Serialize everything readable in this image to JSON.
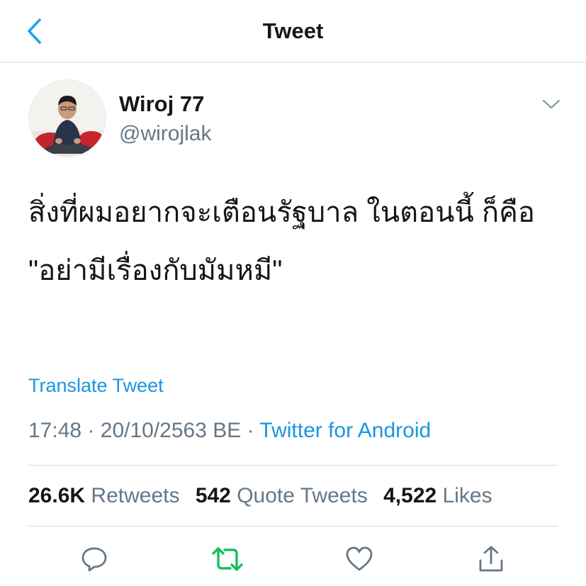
{
  "header": {
    "title": "Tweet",
    "back_icon": "chevron-left-icon"
  },
  "author": {
    "display_name": "Wiroj 77",
    "handle": "@wirojlak",
    "avatar": "avatar-photo"
  },
  "tweet": {
    "paragraphs": [
      "สิ่งที่ผมอยากจะเตือนรัฐบาล ในตอนนี้ ก็คือ",
      "\"อย่ามีเรื่องกับมัมหมี\""
    ],
    "translate_label": "Translate Tweet",
    "time": "17:48",
    "date": "20/10/2563 BE",
    "separator": "·",
    "source": "Twitter for Android"
  },
  "stats": {
    "retweets_count": "26.6K",
    "retweets_label": "Retweets",
    "quote_count": "542",
    "quote_label": "Quote Tweets",
    "likes_count": "4,522",
    "likes_label": "Likes"
  },
  "actions": [
    "reply-icon",
    "retweet-icon",
    "like-icon",
    "share-icon"
  ],
  "colors": {
    "link_blue": "#1b95e0",
    "back_blue": "#1da1f2",
    "retweet_green": "#17bf63",
    "secondary_gray": "#657786",
    "text_dark": "#14171a",
    "divider": "#d4d8db"
  }
}
